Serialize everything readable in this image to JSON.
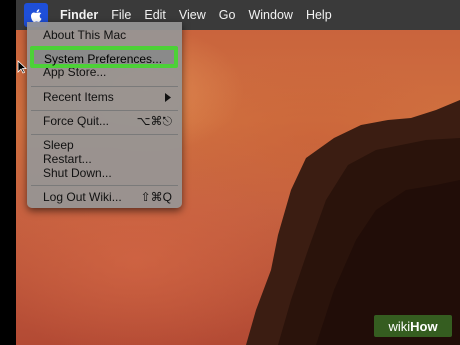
{
  "menubar": {
    "app_name": "Finder",
    "items": [
      "File",
      "Edit",
      "View",
      "Go",
      "Window",
      "Help"
    ]
  },
  "apple_menu": {
    "items": {
      "about": "About This Mac",
      "system_preferences": "System Preferences...",
      "app_store": "App Store...",
      "recent_items": "Recent Items",
      "force_quit": "Force Quit...",
      "force_quit_shortcut": "⌥⌘⎋",
      "sleep": "Sleep",
      "restart": "Restart...",
      "shut_down": "Shut Down...",
      "log_out": "Log Out Wiki...",
      "log_out_shortcut": "⇧⌘Q"
    }
  },
  "watermark": {
    "prefix": "wiki",
    "suffix": "How"
  },
  "colors": {
    "highlight_border": "#4cd137",
    "apple_menu_selected": "#1e4fd8",
    "menubar": "#3a3a3a"
  },
  "icons": [
    "apple-icon",
    "submenu-arrow-icon",
    "mouse-cursor-icon"
  ]
}
